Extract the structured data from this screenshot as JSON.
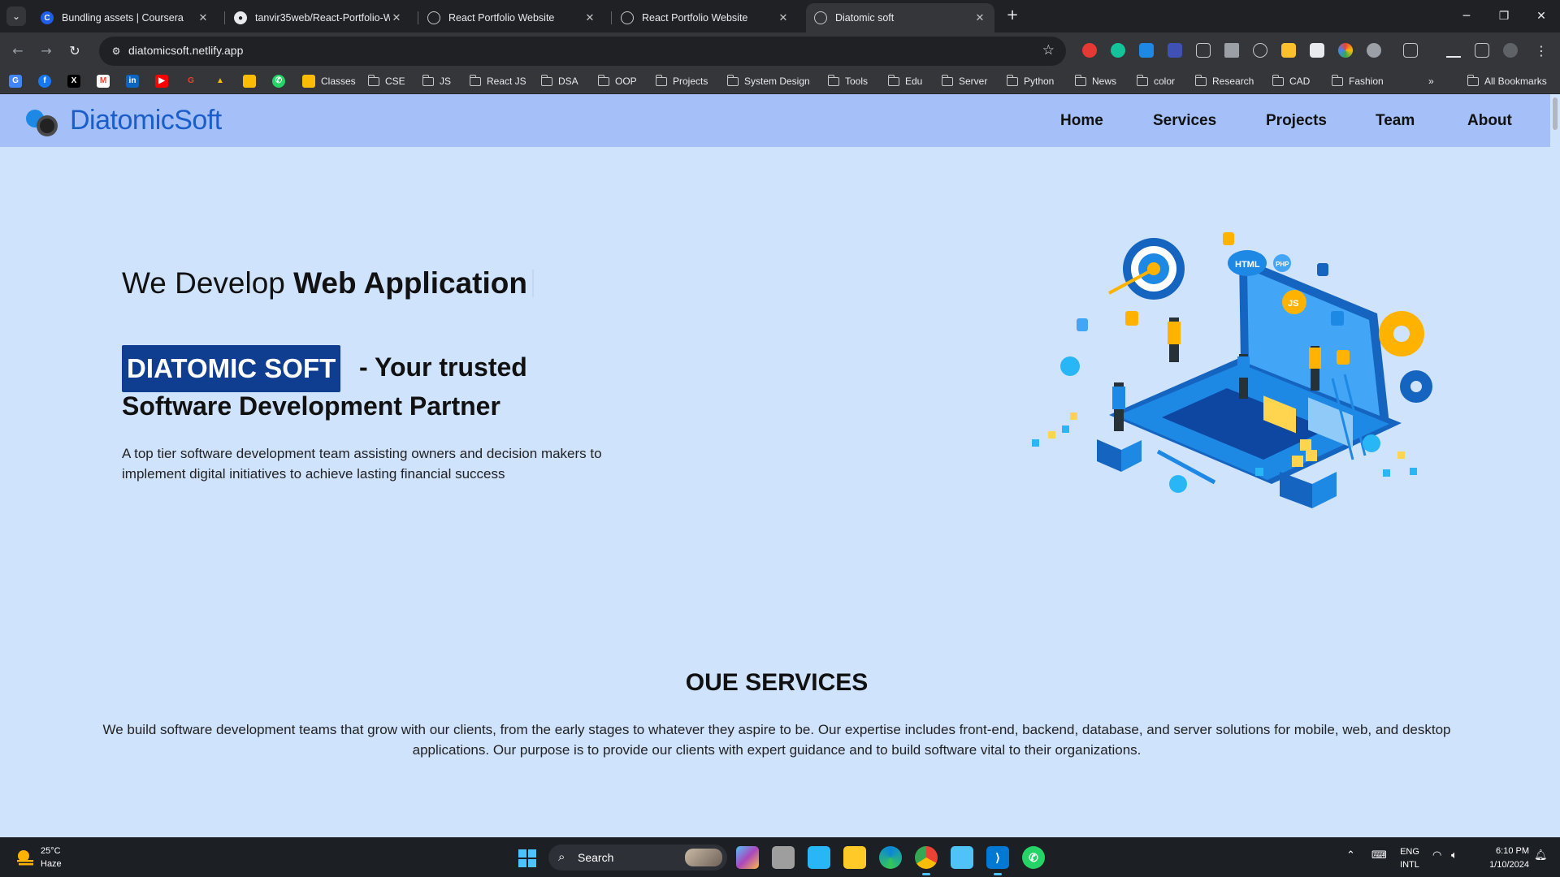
{
  "browser": {
    "tabs": [
      {
        "title": "Bundling assets | Coursera",
        "icon": "coursera-icon"
      },
      {
        "title": "tanvir35web/React-Portfolio-W",
        "icon": "github-icon"
      },
      {
        "title": "React Portfolio Website",
        "icon": "globe-icon"
      },
      {
        "title": "React Portfolio Website",
        "icon": "globe-icon"
      },
      {
        "title": "Diatomic soft",
        "icon": "globe-icon",
        "active": true
      }
    ],
    "url": "diatomicsoft.netlify.app",
    "bookmarks": {
      "folders": [
        "Classes",
        "CSE",
        "JS",
        "React JS",
        "DSA",
        "OOP",
        "Projects",
        "System Design",
        "Tools",
        "Edu",
        "Server",
        "Python",
        "News",
        "color",
        "Research",
        "CAD",
        "Fashion"
      ],
      "all_bookmarks_label": "All Bookmarks",
      "more_label": "»"
    }
  },
  "site": {
    "logo": {
      "text": "DiatomicSoft"
    },
    "nav": [
      "Home",
      "Services",
      "Projects",
      "Team",
      "About"
    ],
    "hero": {
      "prefix": "We Develop ",
      "typed": "Web Application",
      "brand": "DIATOMIC SOFT",
      "tagline_line1": "- Your trusted",
      "tagline_line2": "Software Development Partner",
      "description": "A top tier software development team assisting owners and decision makers to implement digital initiatives to achieve lasting financial success"
    },
    "services": {
      "title": "OUE SERVICES",
      "description": "We build software development teams that grow with our clients, from the early stages to whatever they aspire to be. Our expertise includes front-end, backend, database, and server solutions for mobile, web, and desktop applications. Our purpose is to provide our clients with expert guidance and to build software vital to their organizations."
    },
    "illustration_labels": [
      "HTML",
      "JS",
      "PHP"
    ]
  },
  "taskbar": {
    "weather": {
      "temp": "25°C",
      "condition": "Haze"
    },
    "search_label": "Search",
    "language": {
      "line1": "ENG",
      "line2": "INTL"
    },
    "clock": {
      "time": "6:10 PM",
      "date": "1/10/2024"
    }
  },
  "colors": {
    "page_bg": "#d0e3fd",
    "nav_bg": "#a5c0f8",
    "brand_badge": "#0f3d8f",
    "logo_blue": "#1b5ec9"
  }
}
